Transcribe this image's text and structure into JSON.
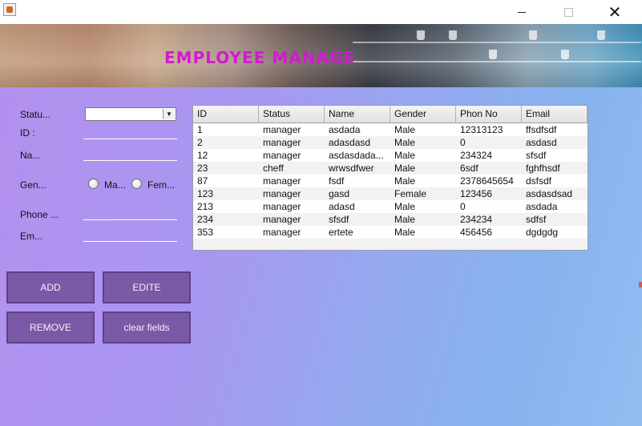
{
  "window": {
    "icon": "java-icon",
    "minimize_icon": "minimize-icon",
    "maximize_icon": "maximize-icon",
    "close_glyph": "✕"
  },
  "banner": {
    "title": "EMPLOYEE MANAGE"
  },
  "form": {
    "status_label": "Statu...",
    "status_value": "",
    "combo_arrow": "▼",
    "id_label": "ID :",
    "id_value": "",
    "name_label": "Na...",
    "name_value": "",
    "gender_label": "Gen...",
    "gender_male": "Ma...",
    "gender_female": "Fem...",
    "phone_label": "Phone ...",
    "phone_value": "",
    "email_label": "Em...",
    "email_value": ""
  },
  "buttons": {
    "add": "ADD",
    "edit": "EDITE",
    "remove": "REMOVE",
    "clear": "clear fields"
  },
  "table": {
    "columns": [
      "ID",
      "Status",
      "Name",
      "Gender",
      "Phon No",
      "Email"
    ],
    "rows": [
      [
        "1",
        "manager",
        "asdada",
        "Male",
        "12313123",
        "ffsdfsdf"
      ],
      [
        "2",
        "manager",
        "adasdasd",
        "Male",
        "0",
        "asdasd"
      ],
      [
        "12",
        "manager",
        "asdasdada...",
        "Male",
        "234324",
        "sfsdf"
      ],
      [
        "23",
        "cheff",
        "wrwsdfwer",
        "Male",
        "6sdf",
        "fghfhsdf"
      ],
      [
        "87",
        "manager",
        "fsdf",
        "Male",
        "2378645654",
        "dsfsdf"
      ],
      [
        "123",
        "manager",
        "gasd",
        "Female",
        "123456",
        "asdasdsad"
      ],
      [
        "213",
        "manager",
        "adasd",
        "Male",
        "0",
        "asdada"
      ],
      [
        "234",
        "manager",
        "sfsdf",
        "Male",
        "234234",
        "sdfsf"
      ],
      [
        "353",
        "manager",
        "ertete",
        "Male",
        "456456",
        "dgdgdg"
      ]
    ]
  },
  "colors": {
    "banner_title": "#d21ad0",
    "button_bg": "#7a59a6",
    "button_border": "#5e3f8c"
  }
}
